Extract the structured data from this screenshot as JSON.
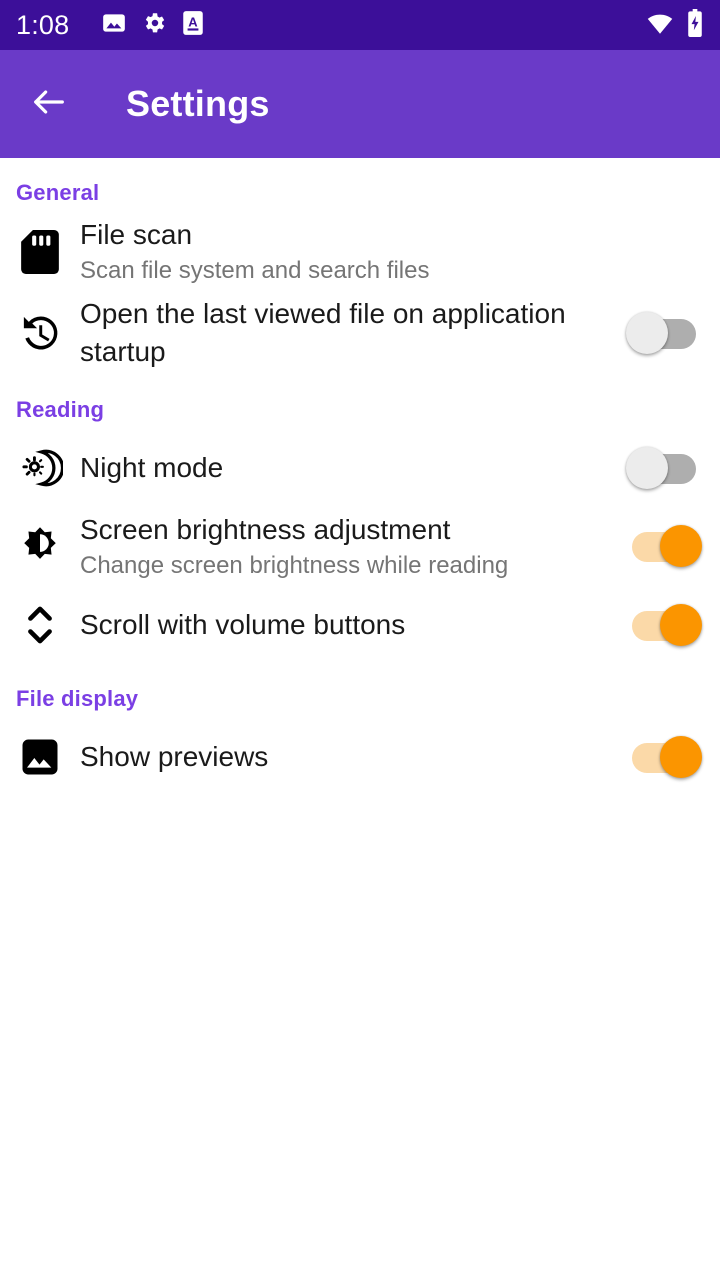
{
  "status_bar": {
    "clock": "1:08",
    "left_icons": [
      "image-icon",
      "gear-icon",
      "document-a-icon"
    ],
    "right_icons": [
      "wifi-icon",
      "battery-charging-icon"
    ],
    "background": "#3C0F99"
  },
  "app_bar": {
    "back_icon": "arrow-left-icon",
    "title": "Settings",
    "background": "#6A3AC8"
  },
  "colors": {
    "section_header": "#7B3FE4",
    "switch_on": "#FB9500",
    "switch_on_track": "#FBD9A8",
    "switch_off_thumb": "#ECECEC",
    "switch_off_track": "#AEAEAE",
    "title_text": "#1a1a1a",
    "subtitle_text": "#757575"
  },
  "sections": [
    {
      "header": "General",
      "rows": [
        {
          "icon": "sd-card-icon",
          "title": "File scan",
          "subtitle": "Scan file system and search files",
          "has_switch": false,
          "switch_state": ""
        },
        {
          "icon": "history-restore-icon",
          "title": "Open the last viewed file on application startup",
          "subtitle": "",
          "has_switch": true,
          "switch_state": "off"
        }
      ]
    },
    {
      "header": "Reading",
      "rows": [
        {
          "icon": "night-mode-moon-icon",
          "title": "Night mode",
          "subtitle": "",
          "has_switch": true,
          "switch_state": "off"
        },
        {
          "icon": "brightness-icon",
          "title": "Screen brightness adjustment",
          "subtitle": "Change screen brightness while reading",
          "has_switch": true,
          "switch_state": "on"
        },
        {
          "icon": "unfold-more-vertical-icon",
          "title": "Scroll with volume buttons",
          "subtitle": "",
          "has_switch": true,
          "switch_state": "on"
        }
      ]
    },
    {
      "header": "File display",
      "rows": [
        {
          "icon": "image-preview-icon",
          "title": "Show previews",
          "subtitle": "",
          "has_switch": true,
          "switch_state": "on"
        }
      ]
    }
  ]
}
